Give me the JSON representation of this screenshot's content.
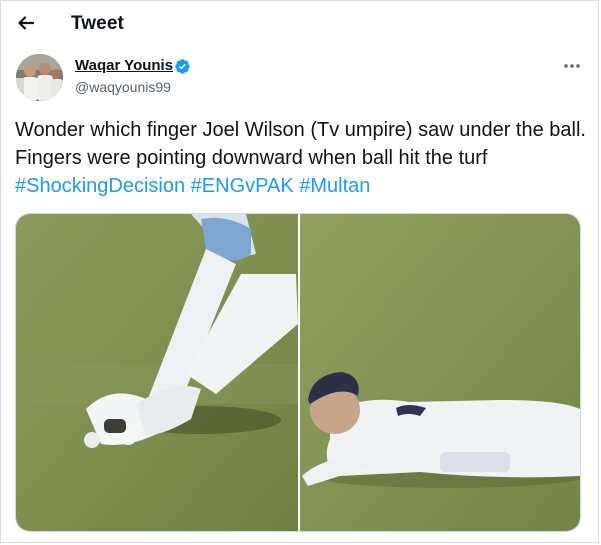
{
  "header": {
    "back_icon": "arrow-left-icon",
    "title": "Tweet"
  },
  "tweet": {
    "author": {
      "name": "Waqar Younis",
      "handle": "@waqyounis99",
      "verified": true,
      "verified_icon": "verified-badge-icon"
    },
    "more_icon": "more-options-icon",
    "text_parts": [
      "Wonder which finger Joel Wilson (Tv umpire) saw under the ball. Fingers were pointing downward when ball hit the turf ",
      "#ShockingDecision",
      " ",
      "#ENGvPAK",
      " ",
      "#Multan"
    ],
    "media": [
      {
        "icon": "photo-keeper-gloves"
      },
      {
        "icon": "photo-diving-fielder"
      }
    ]
  },
  "colors": {
    "accent": "#1d9bf0",
    "text": "#0f1419",
    "secondary": "#536471",
    "border": "#cfd9de"
  }
}
